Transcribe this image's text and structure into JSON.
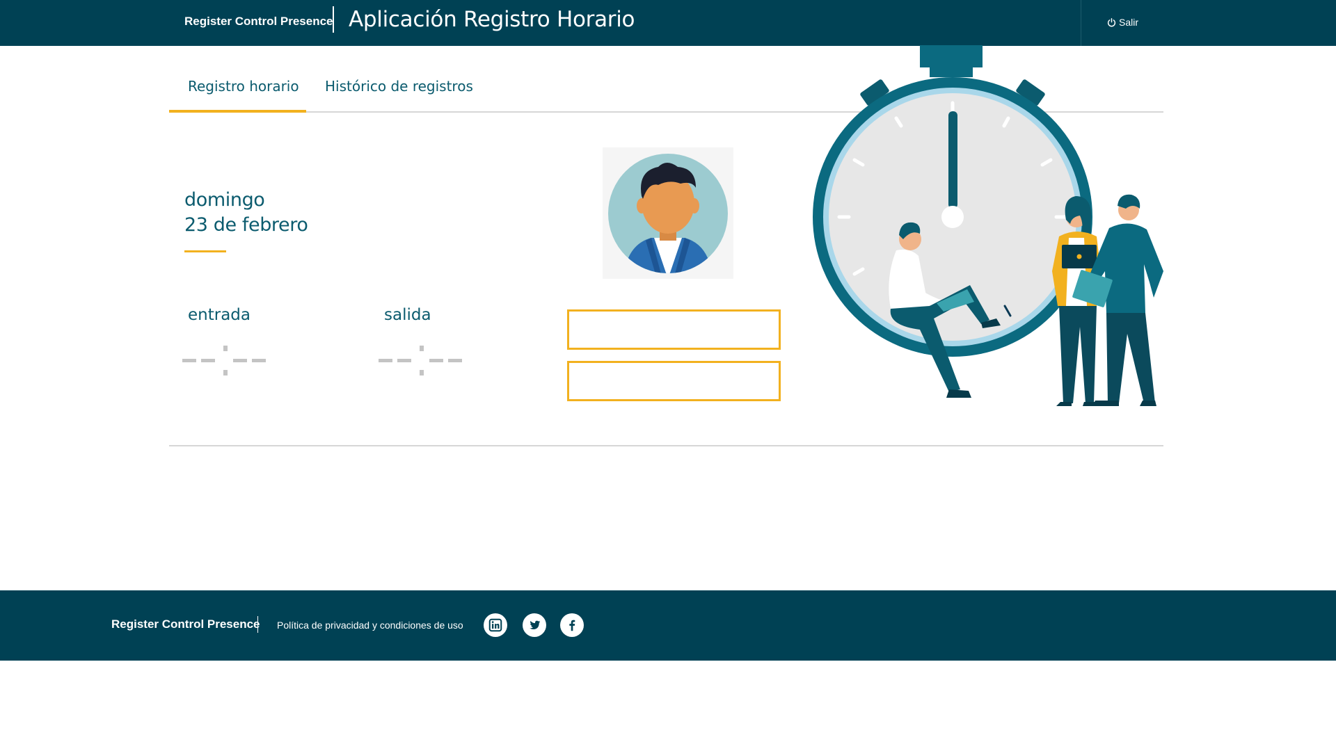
{
  "header": {
    "brand": "Register Control Presence",
    "app_title": "Aplicación Registro Horario",
    "logout_label": "Salir"
  },
  "tabs": [
    {
      "label": "Registro horario",
      "active": true
    },
    {
      "label": "Histórico de registros",
      "active": false
    }
  ],
  "date": {
    "weekday": "domingo",
    "day_month": "23 de febrero"
  },
  "times": {
    "entry_label": "entrada",
    "exit_label": "salida"
  },
  "footer": {
    "brand": "Register Control Presence",
    "privacy_link": "Política de privacidad y condiciones de uso",
    "social": [
      "linkedin-icon",
      "twitter-icon",
      "facebook-icon"
    ]
  },
  "colors": {
    "primary": "#004154",
    "accent": "#f2b11f",
    "text": "#0b5b6e"
  }
}
